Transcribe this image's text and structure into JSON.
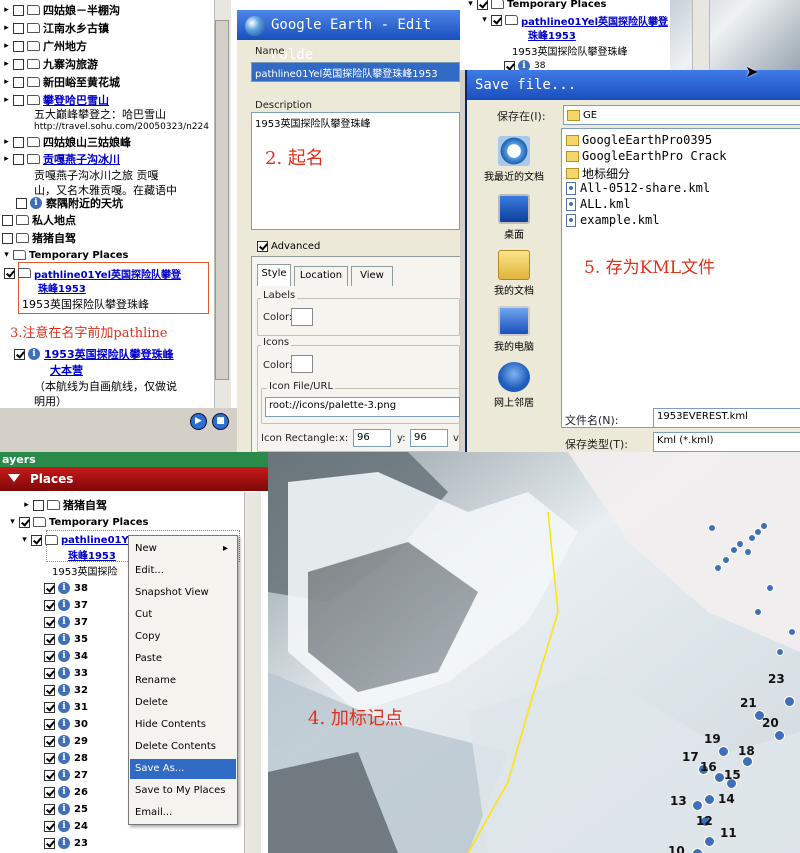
{
  "tree_top": {
    "rows": [
      {
        "label": "四姑娘－半棚沟",
        "bold": true
      },
      {
        "label": "江南水乡古镇",
        "bold": true
      },
      {
        "label": "广州地方",
        "bold": true
      },
      {
        "label": "九寨沟旅游",
        "bold": true
      },
      {
        "label": "新田峪至黄花城",
        "bold": true
      },
      {
        "label": "攀登哈巴雪山",
        "link": true
      },
      {
        "label": "四姑娘山三姑娘峰",
        "bold": true
      },
      {
        "label": "贡嘎燕子沟冰川",
        "link": true
      },
      {
        "label": "察隅附近的天坑",
        "bold": true
      },
      {
        "label": "私人地点",
        "bold": true
      },
      {
        "label": "猪猪自驾",
        "bold": true
      },
      {
        "label": "Temporary Places"
      }
    ],
    "haba_desc1": "五大巅峰攀登之：哈巴雪山",
    "haba_desc2": "http://travel.sohu.com/20050323/n224",
    "gongga_desc1": "贡嘎燕子沟冰川之旅 贡嘎",
    "gongga_desc2": "山，又名木雅贡嘎。在藏语中",
    "pathline_label1": "pathline01Yel英国探险队攀登",
    "pathline_label2": "珠峰1953",
    "pathline_sub": "1953英国探险队攀登珠峰",
    "base_label1": "1953英国探险队攀登珠峰",
    "base_label2": "大本营",
    "base_desc1": "（本航线为自画航线，仅做说",
    "base_desc2": "明用）"
  },
  "annotations": {
    "step2": "2. 起名",
    "step3": "3.注意在名字前加pathline",
    "step4": "4. 加标记点",
    "step5": "5. 存为KML文件"
  },
  "edit_folder": {
    "title": "Google Earth - Edit Folde",
    "name_label": "Name",
    "name_value": "pathline01Yel英国探险队攀登珠峰1953",
    "description_label": "Description",
    "description_value": "1953英国探险队攀登珠峰",
    "advanced_label": "Advanced",
    "tabs": [
      "Style",
      "Location",
      "View"
    ],
    "labels_group": "Labels",
    "color_label": "Color:",
    "icons_group": "Icons",
    "icon_color_label": "Color:",
    "icon_file_group": "Icon File/URL",
    "icon_file_value": "root://icons/palette-3.png",
    "icon_rect_label": "Icon Rectangle:",
    "x_label": "x:",
    "x_value": "96",
    "y_label": "y:",
    "y_value": "96",
    "w_label": "v"
  },
  "bg_tree": {
    "temp_label": "Temporary Places",
    "pathline_label1": "pathline01Yel英国探险队攀登",
    "pathline_label2": "珠峰1953",
    "sub": "1953英国探险队攀登珠峰",
    "num": "38"
  },
  "save_dialog": {
    "title": "Save file...",
    "save_in_label": "保存在(I):",
    "save_in_value": "GE",
    "shortcuts": [
      "我最近的文档",
      "桌面",
      "我的文档",
      "我的电脑",
      "网上邻居"
    ],
    "files": [
      {
        "name": "GoogleEarthPro0395",
        "type": "folder"
      },
      {
        "name": "GoogleEarthPro Crack",
        "type": "folder"
      },
      {
        "name": "地标细分",
        "type": "folder"
      },
      {
        "name": "All-0512-share.kml",
        "type": "kml"
      },
      {
        "name": "ALL.kml",
        "type": "kml"
      },
      {
        "name": "example.kml",
        "type": "kml"
      }
    ],
    "filename_label": "文件名(N):",
    "filename_value": "1953EVEREST.kml",
    "filetype_label": "保存类型(T):",
    "filetype_value": "Kml (*.kml)"
  },
  "places": {
    "top_label": "ayers",
    "header": "Places",
    "zhuzhu": "猪猪自驾",
    "temp": "Temporary Places",
    "pathline1": "pathline01Y",
    "pathline2": "珠峰1953",
    "sub": "1953英国探险",
    "numbers": [
      "38",
      "37",
      "37",
      "35",
      "34",
      "33",
      "32",
      "31",
      "30",
      "29",
      "28",
      "27",
      "26",
      "25",
      "24",
      "23"
    ]
  },
  "context_menu": {
    "items": [
      "New",
      "Edit...",
      "Snapshot View",
      "Cut",
      "Copy",
      "Paste",
      "Rename",
      "Delete",
      "Hide Contents",
      "Delete Contents",
      "Save As...",
      "Save to My Places",
      "Email..."
    ],
    "highlighted": "Save As..."
  },
  "map_labels": [
    "23",
    "21",
    "20",
    "19",
    "18",
    "17",
    "16",
    "15",
    "14",
    "13",
    "12",
    "11",
    "10"
  ]
}
